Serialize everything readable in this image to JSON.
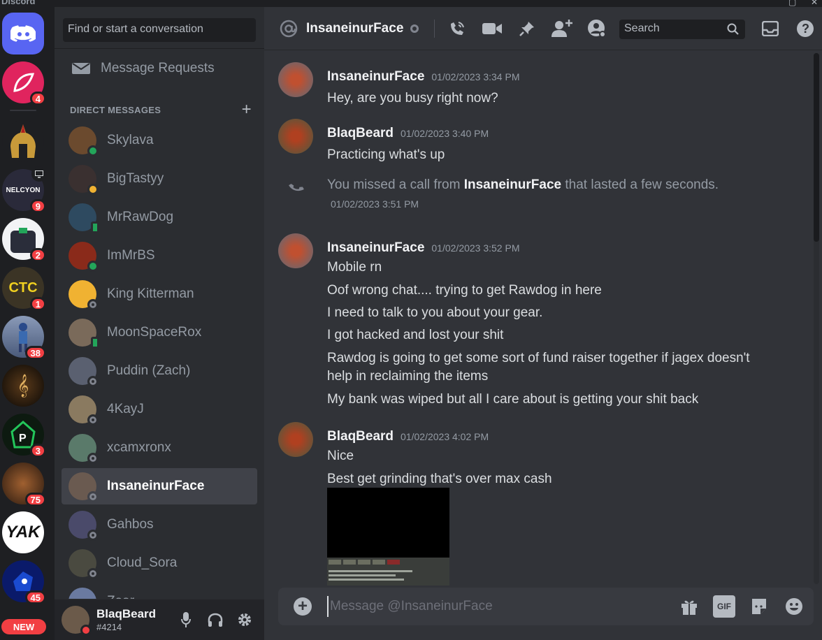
{
  "app": {
    "title": "Discord"
  },
  "servers": [
    {
      "name": "home",
      "badge": ""
    },
    {
      "name": "server-1",
      "badge": "4",
      "color": "#e0245e"
    },
    {
      "name": "server-2",
      "badge": "",
      "color": "#3a3a3a"
    },
    {
      "name": "server-3",
      "badge": "9",
      "color": "#2a2a3a",
      "label": "NELCYON"
    },
    {
      "name": "server-4",
      "badge": "2",
      "color": "#f2f3f5"
    },
    {
      "name": "server-5",
      "badge": "1",
      "color": "#3b3425",
      "label": "CTC"
    },
    {
      "name": "server-6",
      "badge": "38",
      "color": "#6a7a9a"
    },
    {
      "name": "server-7",
      "badge": "",
      "color": "#1a1410"
    },
    {
      "name": "server-8",
      "badge": "3",
      "color": "#101a12"
    },
    {
      "name": "server-9",
      "badge": "75",
      "color": "#3a2a20"
    },
    {
      "name": "server-10",
      "badge": "",
      "color": "#ffffff",
      "label": "YAK"
    },
    {
      "name": "server-11",
      "badge": "45",
      "color": "#0a1a6a"
    }
  ],
  "rail": {
    "new_label": "NEW"
  },
  "dm_sidebar": {
    "search_placeholder": "Find or start a conversation",
    "message_requests": "Message Requests",
    "header": "DIRECT MESSAGES",
    "items": [
      {
        "name": "Skylava",
        "status": "online",
        "color": "#6b4a2e"
      },
      {
        "name": "BigTastyy",
        "status": "idle",
        "color": "#3a3030"
      },
      {
        "name": "MrRawDog",
        "status": "mobile",
        "color": "#2e4a60"
      },
      {
        "name": "ImMrBS",
        "status": "online",
        "color": "#8a2a1a"
      },
      {
        "name": "King Kitterman",
        "status": "offline",
        "color": "#f0b232"
      },
      {
        "name": "MoonSpaceRox",
        "status": "mobile",
        "color": "#7a6a5a"
      },
      {
        "name": "Puddin (Zach)",
        "status": "offline",
        "color": "#5a6070"
      },
      {
        "name": "4KayJ",
        "status": "offline",
        "color": "#8a7a60"
      },
      {
        "name": "xcamxronx",
        "status": "offline",
        "color": "#5a7a6a"
      },
      {
        "name": "InsaneinurFace",
        "status": "offline",
        "color": "#6a5a50",
        "active": true
      },
      {
        "name": "Gahbos",
        "status": "offline",
        "color": "#4a4a6a"
      },
      {
        "name": "Cloud_Sora",
        "status": "offline",
        "color": "#4a4a40"
      },
      {
        "name": "Zaar",
        "status": "offline",
        "color": "#6a7aa0"
      }
    ]
  },
  "user_panel": {
    "name": "BlaqBeard",
    "tag": "#4214"
  },
  "chat": {
    "recipient": "InsaneinurFace",
    "search_placeholder": "Search",
    "composer_placeholder": "Message @InsaneinurFace",
    "gif_label": "GIF",
    "messages": [
      {
        "author": "InsaneinurFace",
        "time": "01/02/2023 3:34 PM",
        "lines": [
          "Hey, are you busy right now?"
        ]
      },
      {
        "author": "BlaqBeard",
        "time": "01/02/2023 3:40 PM",
        "lines": [
          "Practicing what's up"
        ]
      },
      {
        "author": "InsaneinurFace",
        "time": "01/02/2023 3:52 PM",
        "lines": [
          "Mobile rn",
          "Oof wrong chat.... trying to get Rawdog in here",
          "I need to talk to you about your gear.",
          "I got hacked and lost your shit",
          "Rawdog is going to get some sort of fund raiser together if jagex doesn't help in reclaiming the items",
          "My bank was wiped but all I care about is getting your shit back"
        ]
      },
      {
        "author": "BlaqBeard",
        "time": "01/02/2023 4:02 PM",
        "lines": [
          "Nice",
          "Best get grinding that's over max cash"
        ]
      }
    ],
    "missed_call": {
      "prefix": "You missed a call from",
      "caller": "InsaneinurFace",
      "suffix": "that lasted a few seconds.",
      "time": "01/02/2023 3:51 PM"
    }
  }
}
